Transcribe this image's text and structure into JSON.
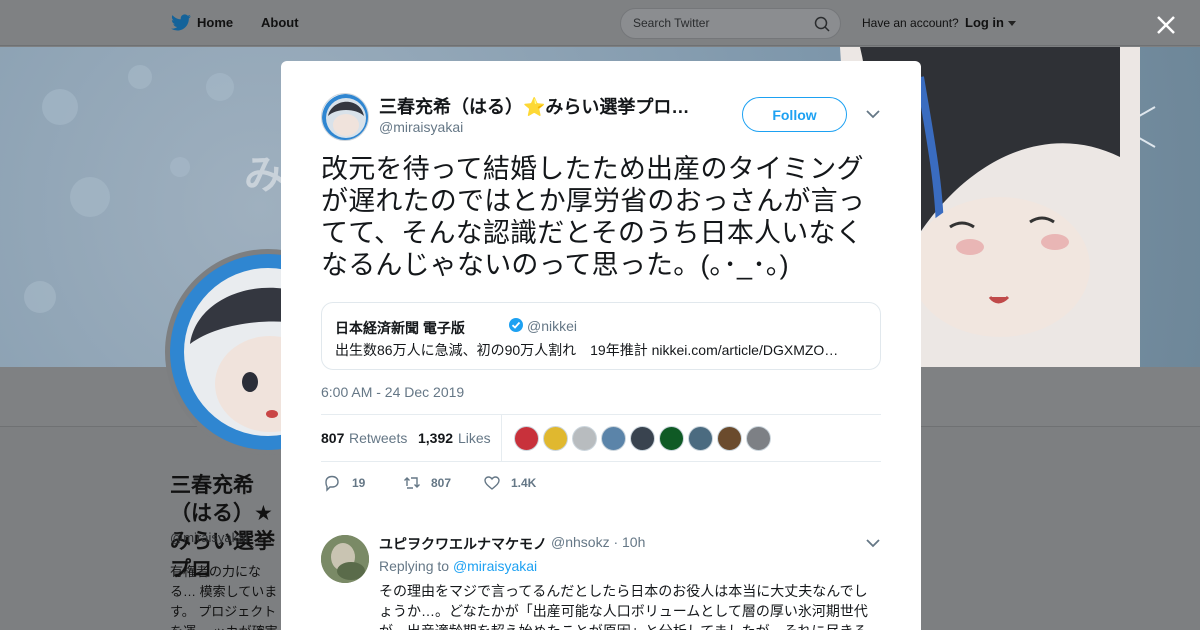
{
  "nav": {
    "home_label": "Home",
    "about_label": "About",
    "search_placeholder": "Search Twitter",
    "have_account": "Have an account?",
    "login_label": "Log in"
  },
  "profile": {
    "banner_text": "み",
    "name": "三春充希（はる）★みらい選挙プロ",
    "handle": "@miraisyakai",
    "bio": "有権者の力になる… 模索しています。 プロジェクトを運… ッカが確実です"
  },
  "tweet": {
    "author_name": "三春充希（はる）⭐みらい選挙プロ…",
    "author_handle": "@miraisyakai",
    "follow_label": "Follow",
    "text": "改元を待って結婚したため出産のタイミングが遅れたのではとか厚労省のおっさんが言ってて、そんな認識だとそのうち日本人いなくなるんじゃないのって思った。(｡･_･｡)",
    "quote": {
      "name": "日本経済新聞 電子版",
      "handle": "@nikkei",
      "text": "出生数86万人に急減、初の90万人割れ　19年推計 nikkei.com/article/DGXMZO…"
    },
    "timestamp": "6:00 AM - 24 Dec 2019",
    "retweets_count": "807",
    "retweets_label": "Retweets",
    "likes_count": "1,392",
    "likes_label": "Likes",
    "liker_colors": [
      "#c8313b",
      "#e0b82f",
      "#b8bcbf",
      "#5b84a9",
      "#39434f",
      "#0f5a25",
      "#4b6b80",
      "#6b4b2d",
      "#7d8085"
    ],
    "actions": {
      "replies": "19",
      "retweets": "807",
      "likes": "1.4K"
    }
  },
  "reply": {
    "name": "ユピヲクワエルナマケモノ",
    "handle": "@nhsokz · 10h",
    "replying_prefix": "Replying to",
    "replying_to": "@miraisyakai",
    "text": "その理由をマジで言ってるんだとしたら日本のお役人は本当に大丈夫なんでしょうか…。どなたかが「出産可能な人口ボリュームとして層の厚い氷河期世代が、出産適齢期を超え始めたことが原因」と分析してましたが、それに尽きる"
  },
  "colors": {
    "accent": "#1da1f2",
    "overlay": "#7d7f81",
    "text_secondary": "#657786"
  }
}
